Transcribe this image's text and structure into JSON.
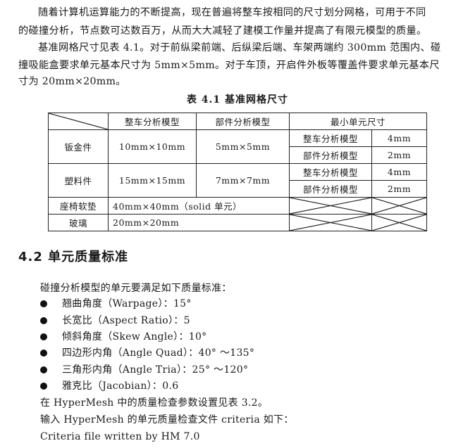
{
  "paragraphs": [
    "随着计算机运算能力的不断提高，现在普遍将整车按相同的尺寸划分网格，可用于不同",
    "的碰撞分析，节点数可达数百万，从而大大减轻了建模工作量并提高了有限元模型的质量。",
    "基准网格尺寸见表 4.1。对于前纵梁前端、后纵梁后端、车架两端约 300mm 范围内、碰",
    "撞吸能盒要求单元基本尺寸为 5mm×5mm。对于车顶，开启件外板等覆盖件要求单元基本尺",
    "寸为 20mm×20mm。"
  ],
  "table": {
    "caption": "表 4.1 基准网格尺寸",
    "headers": [
      "",
      "整车分析模型",
      "部件分析模型",
      "最小单元尺寸"
    ],
    "rows": [
      {
        "part": "钣金件",
        "full": "10mm×10mm",
        "component": "5mm×5mm",
        "min": [
          {
            "model": "整车分析模型",
            "size": "4mm"
          },
          {
            "model": "部件分析模型",
            "size": "2mm"
          }
        ]
      },
      {
        "part": "塑料件",
        "full": "15mm×15mm",
        "component": "7mm×7mm",
        "min": [
          {
            "model": "整车分析模型",
            "size": "4mm"
          },
          {
            "model": "部件分析模型",
            "size": "2mm"
          }
        ]
      },
      {
        "part": "座椅软垫",
        "merged": "40mm×40mm（solid 单元）"
      },
      {
        "part": "玻璃",
        "merged": "20mm×20mm"
      }
    ]
  },
  "section": {
    "heading": "4.2  单元质量标准",
    "intro": "碰撞分析模型的单元要满足如下质量标准：",
    "bullets": [
      "翘曲角度（Warpage）：15°",
      "长宽比（Aspect Ratio）：5",
      "倾斜角度（Skew Angle）：10°",
      "四边形内角（Angle Quad）：40° ～135°",
      "三角形内角（Angle Tria）：25° ～120°",
      "雅克比（Jacobian）：0.6"
    ],
    "lines": [
      "在 HyperMesh 中的质量检查参数设置见表 3.2。",
      "输入 HyperMesh 的单元质量检查文件 criteria 如下：",
      "Criteria file written by HM 7.0"
    ]
  }
}
